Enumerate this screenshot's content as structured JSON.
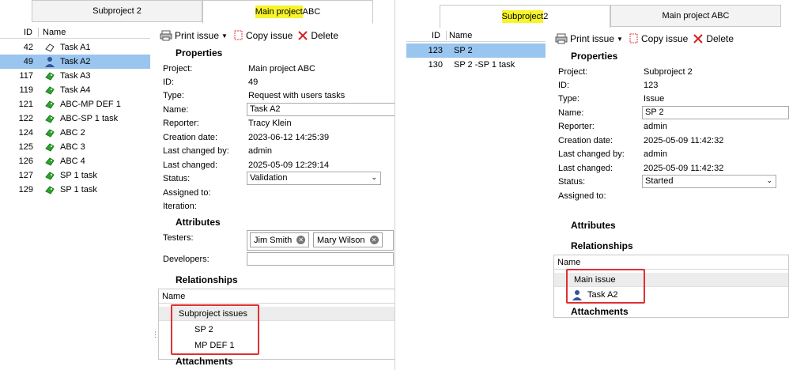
{
  "colors": {
    "highlight": "#f7f42a",
    "selected_row": "#99c5ee",
    "callout": "#e03030",
    "ticket_green": "#2aa52a"
  },
  "left": {
    "tabs": [
      {
        "label": "Subproject 2"
      },
      {
        "label_hl": "Main project",
        "label_rest": " ABC"
      }
    ],
    "grid": {
      "headers": {
        "id": "ID",
        "name": "Name"
      },
      "rows": [
        {
          "id": "42",
          "name": "Task A1",
          "icon": "ticket-outline-icon"
        },
        {
          "id": "49",
          "name": "Task A2",
          "icon": "user-icon"
        },
        {
          "id": "117",
          "name": "Task A3",
          "icon": "ticket-icon"
        },
        {
          "id": "119",
          "name": "Task A4",
          "icon": "ticket-icon"
        },
        {
          "id": "121",
          "name": "ABC-MP DEF 1",
          "icon": "ticket-icon"
        },
        {
          "id": "122",
          "name": "ABC-SP 1 task",
          "icon": "ticket-icon"
        },
        {
          "id": "124",
          "name": "ABC 2",
          "icon": "ticket-icon"
        },
        {
          "id": "125",
          "name": "ABC 3",
          "icon": "ticket-icon"
        },
        {
          "id": "126",
          "name": "ABC 4",
          "icon": "ticket-icon"
        },
        {
          "id": "127",
          "name": "SP 1 task",
          "icon": "ticket-icon"
        },
        {
          "id": "129",
          "name": "SP 1 task",
          "icon": "ticket-icon"
        }
      ]
    },
    "toolbar": {
      "print": "Print issue",
      "copy": "Copy issue",
      "delete": "Delete"
    },
    "properties": {
      "title": "Properties",
      "project_label": "Project:",
      "project": "Main project ABC",
      "id_label": "ID:",
      "id": "49",
      "type_label": "Type:",
      "type": "Request with users tasks",
      "name_label": "Name:",
      "name": "Task A2",
      "reporter_label": "Reporter:",
      "reporter": "Tracy Klein",
      "created_label": "Creation date:",
      "created": "2023-06-12 14:25:39",
      "changed_by_label": "Last changed by:",
      "changed_by": "admin",
      "changed_label": "Last changed:",
      "changed": "2025-05-09 12:29:14",
      "status_label": "Status:",
      "status": "Validation",
      "assigned_label": "Assigned to:",
      "iteration_label": "Iteration:"
    },
    "attributes": {
      "title": "Attributes",
      "testers_label": "Testers:",
      "testers": [
        "Jim Smith",
        "Mary Wilson"
      ],
      "developers_label": "Developers:"
    },
    "relationships": {
      "title": "Relationships",
      "col": "Name",
      "group": "Subproject issues",
      "items": [
        "SP 2",
        "MP DEF 1"
      ]
    },
    "attachments": "Attachments"
  },
  "right": {
    "tabs": [
      {
        "label_hl": "Subproject",
        "label_rest": " 2"
      },
      {
        "label": "Main project ABC"
      }
    ],
    "grid": {
      "headers": {
        "id": "ID",
        "name": "Name"
      },
      "rows": [
        {
          "id": "123",
          "name": "SP 2"
        },
        {
          "id": "130",
          "name": "SP 2 -SP 1 task"
        }
      ]
    },
    "toolbar": {
      "print": "Print issue",
      "copy": "Copy issue",
      "delete": "Delete"
    },
    "properties": {
      "title": "Properties",
      "project_label": "Project:",
      "project": "Subproject 2",
      "id_label": "ID:",
      "id": "123",
      "type_label": "Type:",
      "type": "Issue",
      "name_label": "Name:",
      "name": "SP 2",
      "reporter_label": "Reporter:",
      "reporter": "admin",
      "created_label": "Creation date:",
      "created": "2025-05-09 11:42:32",
      "changed_by_label": "Last changed by:",
      "changed_by": "admin",
      "changed_label": "Last changed:",
      "changed": "2025-05-09 11:42:32",
      "status_label": "Status:",
      "status": "Started",
      "assigned_label": "Assigned to:"
    },
    "attributes": {
      "title": "Attributes"
    },
    "relationships": {
      "title": "Relationships",
      "col": "Name",
      "group": "Main issue",
      "items": [
        "Task A2"
      ]
    },
    "attachments": "Attachments"
  }
}
